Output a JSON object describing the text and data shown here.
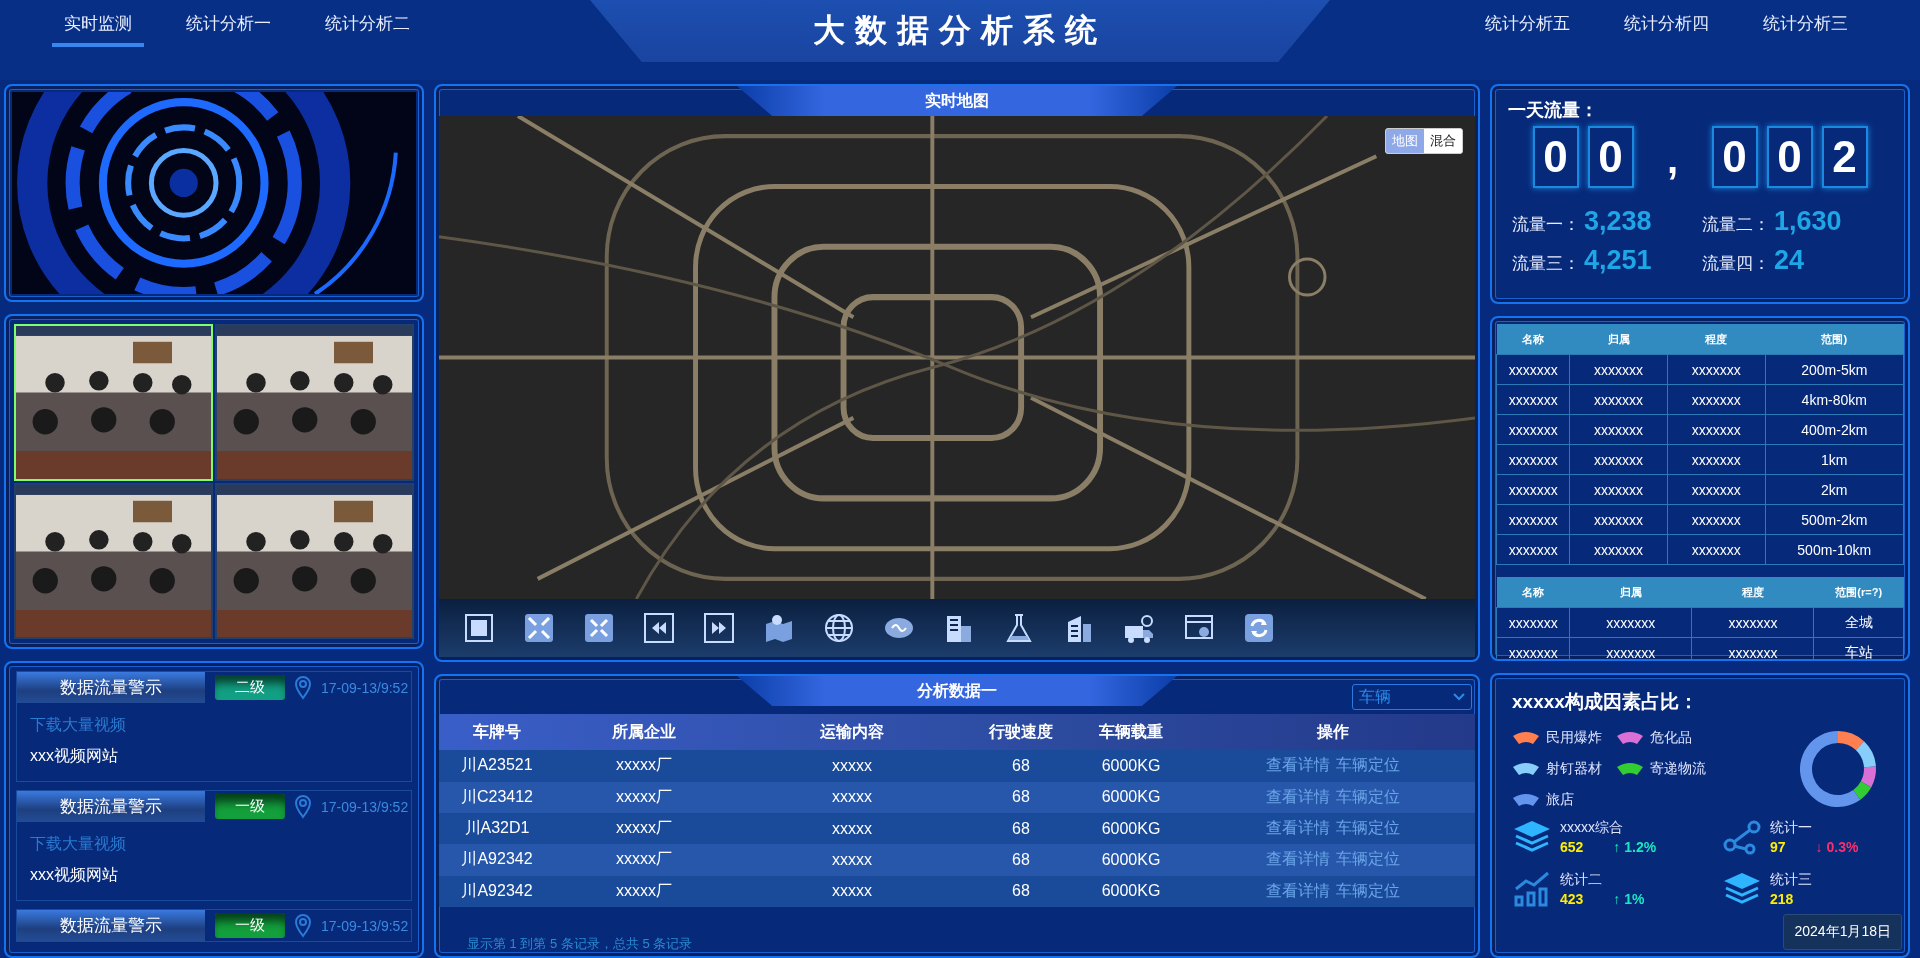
{
  "nav_left": [
    {
      "label": "实时监测",
      "selected": true
    },
    {
      "label": "统计分析一",
      "selected": false
    },
    {
      "label": "统计分析二",
      "selected": false
    }
  ],
  "title": "大数据分析系统",
  "nav_right": [
    {
      "label": "统计分析五",
      "selected": false
    },
    {
      "label": "统计分析四",
      "selected": false
    },
    {
      "label": "统计分析三",
      "selected": false
    }
  ],
  "cameras": [
    {
      "selected": true
    },
    {
      "selected": false
    },
    {
      "selected": false
    },
    {
      "selected": false
    }
  ],
  "alerts": [
    {
      "title": "数据流量警示",
      "level": "二级",
      "color": "#12a084",
      "time": "17-09-13/9:52",
      "link": "下载大量视频",
      "site": "xxx视频网站"
    },
    {
      "title": "数据流量警示",
      "level": "一级",
      "color": "#13a03c",
      "time": "17-09-13/9:52",
      "link": "下载大量视频",
      "site": "xxx视频网站"
    },
    {
      "title": "数据流量警示",
      "level": "一级",
      "color": "#13a03c",
      "time": "17-09-13/9:52"
    }
  ],
  "map": {
    "title": "实时地图",
    "map_types": [
      {
        "label": "地图",
        "selected": true
      },
      {
        "label": "混合",
        "selected": false
      }
    ]
  },
  "table": {
    "title": "分析数据一",
    "filter": "车辆",
    "columns": [
      "车牌号",
      "所属企业",
      "运输内容",
      "行驶速度",
      "车辆载重",
      "操作"
    ],
    "rows": [
      {
        "cells": [
          "川A23521",
          "xxxxx厂",
          "xxxxx",
          "68",
          "6000KG"
        ],
        "actions": [
          "查看详情",
          "车辆定位"
        ]
      },
      {
        "cells": [
          "川C23412",
          "xxxxx厂",
          "xxxxx",
          "68",
          "6000KG"
        ],
        "actions": [
          "查看详情",
          "车辆定位"
        ]
      },
      {
        "cells": [
          "川A32D1",
          "xxxxx厂",
          "xxxxx",
          "68",
          "6000KG"
        ],
        "actions": [
          "查看详情",
          "车辆定位"
        ]
      },
      {
        "cells": [
          "川A92342",
          "xxxxx厂",
          "xxxxx",
          "68",
          "6000KG"
        ],
        "actions": [
          "查看详情",
          "车辆定位"
        ]
      },
      {
        "cells": [
          "川A92342",
          "xxxxx厂",
          "xxxxx",
          "68",
          "6000KG"
        ],
        "actions": [
          "查看详情",
          "车辆定位"
        ]
      }
    ],
    "footer": "显示第 1 到第 5 条记录，总共 5 条记录"
  },
  "flow": {
    "title": "一天流量：",
    "digits": [
      {
        "kind": "digit",
        "text": "0"
      },
      {
        "kind": "digit",
        "text": "0"
      },
      {
        "kind": "separator",
        "text": ","
      },
      {
        "kind": "digit",
        "text": "0"
      },
      {
        "kind": "digit",
        "text": "0"
      },
      {
        "kind": "digit",
        "text": "2"
      }
    ],
    "stats": [
      {
        "label": "流量一：",
        "value": "3,238"
      },
      {
        "label": "流量二：",
        "value": "1,630"
      },
      {
        "label": "流量三：",
        "value": "4,251"
      },
      {
        "label": "流量四：",
        "value": "24"
      }
    ]
  },
  "range_tables": [
    {
      "columns": [
        "名称",
        "归属",
        "程度",
        "范围)"
      ],
      "rows": [
        [
          "xxxxxxx",
          "xxxxxxx",
          "xxxxxxx",
          "200m-5km"
        ],
        [
          "xxxxxxx",
          "xxxxxxx",
          "xxxxxxx",
          "4km-80km"
        ],
        [
          "xxxxxxx",
          "xxxxxxx",
          "xxxxxxx",
          "400m-2km"
        ],
        [
          "xxxxxxx",
          "xxxxxxx",
          "xxxxxxx",
          "1km"
        ],
        [
          "xxxxxxx",
          "xxxxxxx",
          "xxxxxxx",
          "2km"
        ],
        [
          "xxxxxxx",
          "xxxxxxx",
          "xxxxxxx",
          "500m-2km"
        ],
        [
          "xxxxxxx",
          "xxxxxxx",
          "xxxxxxx",
          "500m-10km"
        ]
      ]
    },
    {
      "columns": [
        "名称",
        "归属",
        "程度",
        "范围(r=?)"
      ],
      "rows": [
        [
          "xxxxxxx",
          "xxxxxxx",
          "xxxxxxx",
          "全城"
        ],
        [
          "xxxxxxx",
          "xxxxxxx",
          "xxxxxxx",
          "车站"
        ]
      ]
    }
  ],
  "composition": {
    "title": "xxxxx构成因素占比：",
    "legend": [
      {
        "label": "民用爆炸",
        "color": "#ff7f50"
      },
      {
        "label": "危化品",
        "color": "#da70d6"
      },
      {
        "label": "射钉器材",
        "color": "#87cefa"
      },
      {
        "label": "寄递物流",
        "color": "#32cd32"
      },
      {
        "label": "旅店",
        "color": "#6495ed"
      }
    ],
    "stats": [
      {
        "kind": "layers",
        "label": "xxxxx综合",
        "value": "652",
        "arrow": "↑",
        "trend": "1.2%",
        "color": "#18e8c0"
      },
      {
        "kind": "nodes",
        "label": "统计一",
        "value": "97",
        "arrow": "↓",
        "trend": "0.3%",
        "color": "#ff2e6a"
      },
      {
        "kind": "chart",
        "label": "统计二",
        "value": "423",
        "arrow": "↑",
        "trend": "1%",
        "color": "#18e8c0"
      },
      {
        "kind": "layers",
        "label": "统计三",
        "value": "218"
      }
    ]
  },
  "date_tooltip": "2024年1月18日"
}
